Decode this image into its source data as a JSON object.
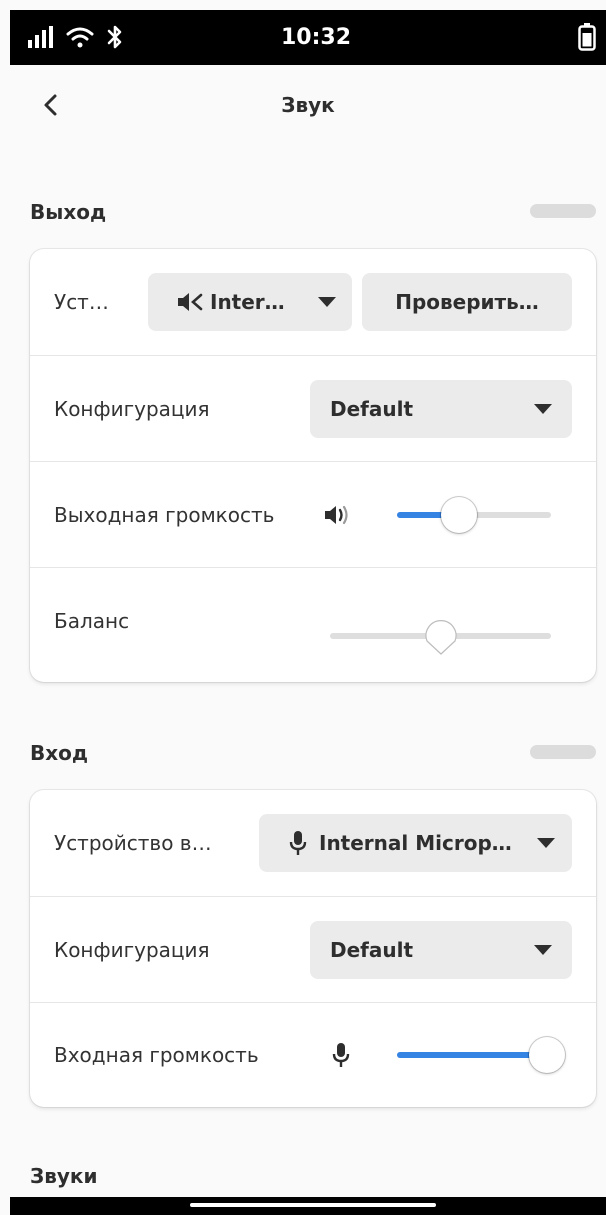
{
  "status": {
    "time": "10:32"
  },
  "header": {
    "title": "Звук"
  },
  "output": {
    "title": "Выход",
    "device_label": "Уст…",
    "device_value": "Inter…",
    "test_button": "Проверить…",
    "config_label": "Конфигурация",
    "config_value": "Default",
    "volume_label": "Выходная громкость",
    "volume_level": 0.4,
    "balance_label": "Баланс",
    "balance_level": 0.5
  },
  "input": {
    "title": "Вход",
    "device_label": "Устройство в…",
    "device_value": "Internal Microp…",
    "config_label": "Конфигурация",
    "config_value": "Default",
    "volume_label": "Входная громкость",
    "volume_level": 1.0
  },
  "sounds": {
    "title": "Звуки"
  },
  "colors": {
    "accent": "#3584e4",
    "status_bar": "#000000",
    "background": "#fafafa"
  }
}
